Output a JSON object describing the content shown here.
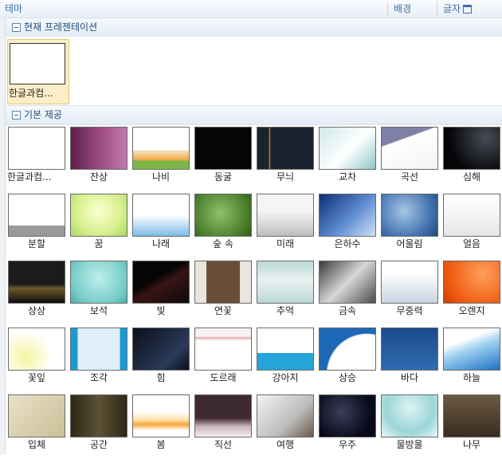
{
  "tabs": {
    "theme": "테마",
    "background": "배경",
    "font": "글자"
  },
  "current_section": {
    "title": "현재 프레젠테이션",
    "item": {
      "label": "한글과컴...",
      "bg": "#ffffff"
    }
  },
  "builtin_section": {
    "title": "기본 제공",
    "items": [
      {
        "label": "한글과컴...",
        "bg": "#ffffff"
      },
      {
        "label": "잔상",
        "bg": "linear-gradient(90deg,#5b1f47,#9b4a82,#c27aaa)"
      },
      {
        "label": "나비",
        "bg": "linear-gradient(#ffffff 55%,#f5e6c8 55%,#f0a33c 80%,#7ab648 80%)"
      },
      {
        "label": "동굴",
        "bg": "#050505"
      },
      {
        "label": "무늬",
        "bg": "linear-gradient(90deg,#1b2330 20%,#c48b2a 22%,#1b2330 24%)"
      },
      {
        "label": "교차",
        "bg": "linear-gradient(135deg,#cfe9ea,#ffffff 55%,#8fc5c9)"
      },
      {
        "label": "곡선",
        "bg": "linear-gradient(160deg,#7f80a8 30%,#ffffff 32%,#f3f3f7)"
      },
      {
        "label": "심해",
        "bg": "radial-gradient(circle at 75% 25%,#474c55,#050608 70%)"
      },
      {
        "label": "분할",
        "bg": "linear-gradient(#ffffff 75%,#9a9a9a 75%)"
      },
      {
        "label": "꿈",
        "bg": "radial-gradient(circle at 50% 40%,#fbffd2,#d9f08f 60%,#a8d86a)"
      },
      {
        "label": "나래",
        "bg": "linear-gradient(#ffffff 50%,#e3f1fb 60%,#7fbde8)"
      },
      {
        "label": "숲 속",
        "bg": "radial-gradient(circle at 45% 45%,#8fc06a,#4a7f2c 70%,#2f5a1a)"
      },
      {
        "label": "미래",
        "bg": "linear-gradient(#f5f5f5 40%,#bdbdbd)"
      },
      {
        "label": "은하수",
        "bg": "linear-gradient(135deg,#0d2f75,#5d8bd1 55%,#d0e2f6)"
      },
      {
        "label": "어울림",
        "bg": "radial-gradient(circle at 40% 40%,#a7c6e6,#4a79b3 60%,#23487f)"
      },
      {
        "label": "얼음",
        "bg": "linear-gradient(#ffffff,#e6e6e6)"
      },
      {
        "label": "상상",
        "bg": "linear-gradient(#1b1b1b 55%,#6b5a29 65%,#0e0e0e)"
      },
      {
        "label": "보석",
        "bg": "radial-gradient(circle at 50% 40%,#bdeeea,#78cdc9 70%,#4daeaa)"
      },
      {
        "label": "빛",
        "bg": "linear-gradient(150deg,#050505 40%,#3a1414 55%,#0a0a0a)"
      },
      {
        "label": "연꽃",
        "bg": "linear-gradient(90deg,#e9e4dc 20%,#6b4e3a 20%,#6b4e3a 80%,#e9e4dc 80%)"
      },
      {
        "label": "추억",
        "bg": "linear-gradient(#bcd8d6,#e9f2f1 45%,#bcd8d6)"
      },
      {
        "label": "금속",
        "bg": "linear-gradient(135deg,#3a3a3a,#d7d7d7 50%,#4c4c4c)"
      },
      {
        "label": "무중력",
        "bg": "linear-gradient(#ffffff 30%,#c6d4e3)"
      },
      {
        "label": "오렌지",
        "bg": "radial-gradient(circle at 70% 30%,#ff9f5a,#f05a10 70%,#c73f00)"
      },
      {
        "label": "꽃잎",
        "bg": "radial-gradient(circle at 30% 70%,#f5f5a0,#ffffff 55%)"
      },
      {
        "label": "조각",
        "bg": "linear-gradient(90deg,#1a9ad0 12%,#dff0f8 12%,#dff0f8 88%,#1a9ad0 88%)"
      },
      {
        "label": "힘",
        "bg": "linear-gradient(135deg,#0c0f18,#2a3a5a 70%,#0c0f18)"
      },
      {
        "label": "도르래",
        "bg": "linear-gradient(#f7f1f1 20%,#e2a7ac 22%,#ffffff 30%)"
      },
      {
        "label": "강아지",
        "bg": "linear-gradient(#ffffff 60%,#26a4d9 60%)"
      },
      {
        "label": "상승",
        "bg": "radial-gradient(circle at 85% 110%,#ffffff 60%,#1d68b5 62%)"
      },
      {
        "label": "바다",
        "bg": "linear-gradient(#1a4a8d,#2f6db0)"
      },
      {
        "label": "하늘",
        "bg": "linear-gradient(160deg,#ffffff 30%,#9fd1f0 50%,#1f71c2)"
      },
      {
        "label": "입체",
        "bg": "linear-gradient(135deg,#e9e1c8,#cbbf97)"
      },
      {
        "label": "공간",
        "bg": "linear-gradient(90deg,#2e2716,#5c5236 50%,#2e2716)"
      },
      {
        "label": "봄",
        "bg": "linear-gradient(#ffffff 40%,#ffe1a8 60%,#f3a43a 70%,#ffffff 85%)"
      },
      {
        "label": "직선",
        "bg": "linear-gradient(#3e2a33 55%,#c9b4bd 75%,#f4eef0)"
      },
      {
        "label": "여행",
        "bg": "linear-gradient(135deg,#f2f2f2,#bdbdbd 60%,#6a5a4a)"
      },
      {
        "label": "우주",
        "bg": "radial-gradient(circle at 40% 40%,#3a3d58,#08091a 70%)"
      },
      {
        "label": "물방울",
        "bg": "radial-gradient(circle at 50% 30%,#dff2f3,#9bd6d8 60%,#e9f6f6)"
      },
      {
        "label": "나무",
        "bg": "linear-gradient(#6b5a44,#3a2c1e)"
      }
    ]
  }
}
